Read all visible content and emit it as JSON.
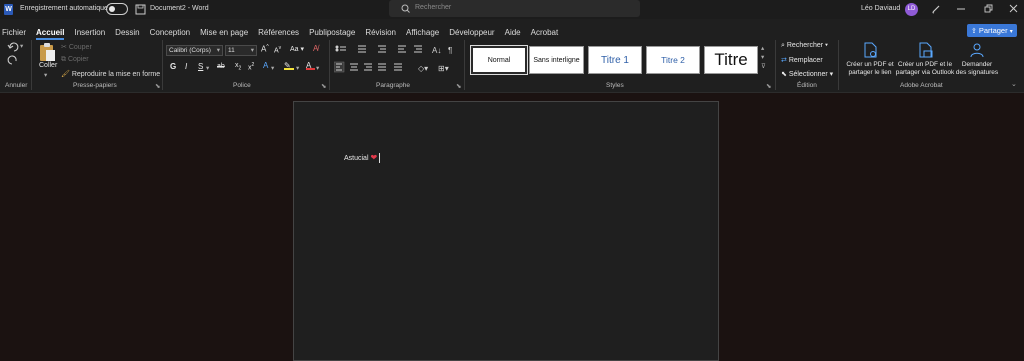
{
  "titlebar": {
    "autosave_label": "Enregistrement automatique",
    "doc_title": "Document2",
    "separator": "-",
    "app_name": "Word",
    "search_placeholder": "Rechercher",
    "user_name": "Léo Daviaud",
    "user_initials": "LD"
  },
  "tabs": [
    "Fichier",
    "Accueil",
    "Insertion",
    "Dessin",
    "Conception",
    "Mise en page",
    "Références",
    "Publipostage",
    "Révision",
    "Affichage",
    "Développeur",
    "Aide",
    "Acrobat"
  ],
  "active_tab": "Accueil",
  "share_label": "Partager",
  "ribbon": {
    "undo_group": "Annuler",
    "clipboard": {
      "paste_label": "Coller",
      "cut_label": "Couper",
      "copy_label": "Copier",
      "format_painter_label": "Reproduire la mise en forme",
      "group_label": "Presse-papiers"
    },
    "font": {
      "font_name": "Calibri (Corps)",
      "font_size": "11",
      "group_label": "Police",
      "bold": "G",
      "italic": "I",
      "underline": "S",
      "strike": "ab",
      "grow": "A",
      "shrink": "A",
      "case": "Aa"
    },
    "paragraph": {
      "group_label": "Paragraphe"
    },
    "styles": {
      "items": [
        "Normal",
        "Sans interligne",
        "Titre 1",
        "Titre 2",
        "Titre"
      ],
      "group_label": "Styles"
    },
    "editing": {
      "find_label": "Rechercher",
      "replace_label": "Remplacer",
      "select_label": "Sélectionner",
      "group_label": "Édition"
    },
    "acrobat": {
      "create_link_line1": "Créer un PDF et",
      "create_link_line2": "partager le lien",
      "create_outlook_line1": "Créer un PDF et le",
      "create_outlook_line2": "partager via Outlook",
      "signatures_line1": "Demander",
      "signatures_line2": "des signatures",
      "group_label": "Adobe Acrobat"
    }
  },
  "document": {
    "text": "Astucial",
    "emoji": "❤️"
  },
  "colors": {
    "accent": "#3a78d8",
    "page_bg": "#1b1211",
    "heart": "#e2394a"
  }
}
